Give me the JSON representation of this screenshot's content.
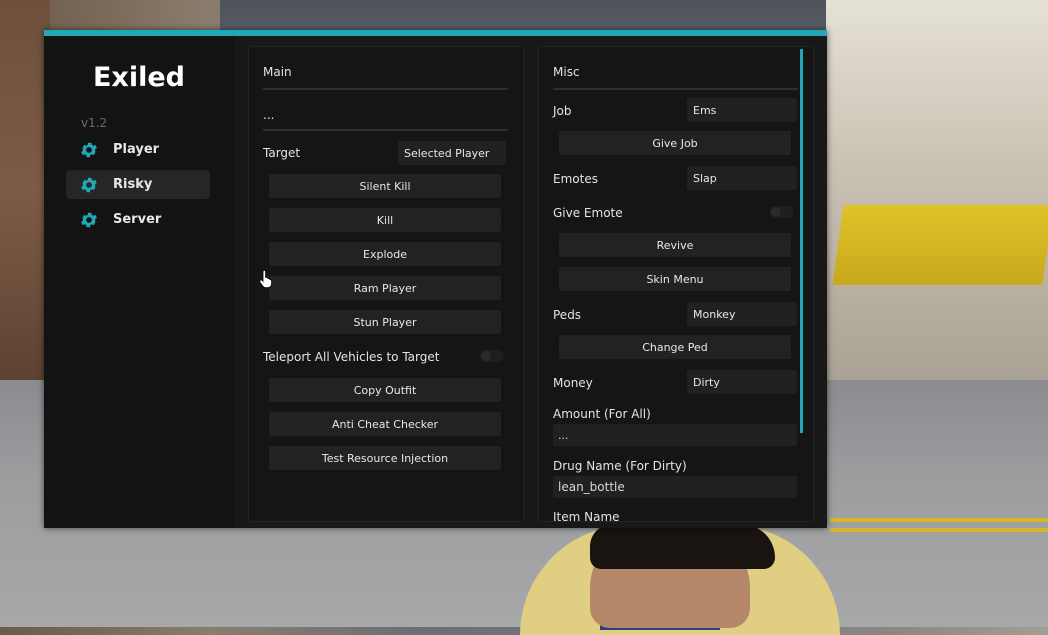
{
  "colors": {
    "accent": "#20a8b8",
    "panel": "#151515",
    "button": "#222222",
    "text": "#e4e4e4"
  },
  "sidebar": {
    "brand": "Exiled",
    "version": "v1.2",
    "items": [
      {
        "label": "Player",
        "icon": "gear-icon",
        "active": false
      },
      {
        "label": "Risky",
        "icon": "gear-icon",
        "active": true
      },
      {
        "label": "Server",
        "icon": "gear-icon",
        "active": false
      }
    ]
  },
  "main": {
    "title": "Main",
    "ellipsis": "...",
    "target_label": "Target",
    "target_value": "Selected Player",
    "buttons1": [
      "Silent Kill",
      "Kill",
      "Explode",
      "Ram Player",
      "Stun Player"
    ],
    "teleport_label": "Teleport All Vehicles to Target",
    "buttons2": [
      "Copy Outfit",
      "Anti Cheat Checker",
      "Test Resource Injection"
    ]
  },
  "misc": {
    "title": "Misc",
    "job_label": "Job",
    "job_value": "Ems",
    "give_job": "Give Job",
    "emotes_label": "Emotes",
    "emotes_value": "Slap",
    "give_emote_label": "Give Emote",
    "revive": "Revive",
    "skin_menu": "Skin Menu",
    "peds_label": "Peds",
    "peds_value": "Monkey",
    "change_ped": "Change Ped",
    "money_label": "Money",
    "money_value": "Dirty",
    "amount_label": "Amount (For All)",
    "amount_value": "...",
    "drug_label": "Drug Name (For Dirty)",
    "drug_value": "lean_bottle",
    "item_label": "Item Name"
  }
}
